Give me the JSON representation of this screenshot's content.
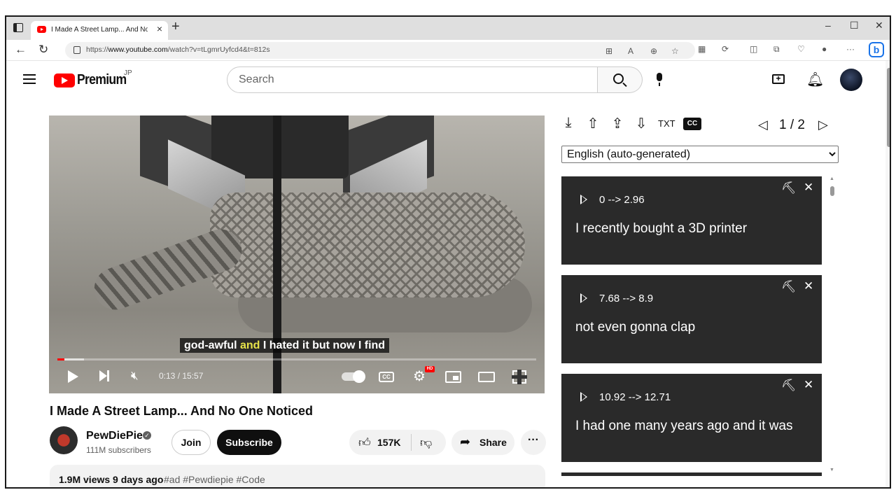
{
  "browser": {
    "tab_title": "I Made A Street Lamp... And No One Noticed",
    "url_prefix": "https://",
    "url_host": "www.youtube.com",
    "url_path": "/watch?v=tLgmrUyfcd4&t=812s"
  },
  "youtube": {
    "logo_text": "Premium",
    "region": "JP",
    "search_placeholder": "Search"
  },
  "player": {
    "caption_pre": "god-awful ",
    "caption_hl": "and",
    "caption_post": " I hated it but now I find",
    "time_display": "0:13 / 15:57",
    "progress_fraction": 0.014,
    "buffer_fraction": 0.055,
    "cc_label": "CC",
    "hd_label": "HD"
  },
  "video": {
    "title": "I Made A Street Lamp... And No One Noticed",
    "channel_name": "PewDiePie",
    "subscribers": "111M subscribers",
    "join_label": "Join",
    "subscribe_label": "Subscribe",
    "likes": "157K",
    "share_label": "Share",
    "more_label": "···",
    "views": "1.9M views  9 days ago",
    "tags": "#ad #Pewdiepie #Code"
  },
  "transcript": {
    "cc_badge": "CC",
    "page_indicator": "1 / 2",
    "language": "English (auto-generated)",
    "segments": [
      {
        "time": "0 --> 2.96",
        "text": "I recently bought a 3D printer"
      },
      {
        "time": "7.68 --> 8.9",
        "text": "not even gonna clap"
      },
      {
        "time": "10.92 --> 12.71",
        "text": "I had one many years ago and it was"
      }
    ]
  }
}
